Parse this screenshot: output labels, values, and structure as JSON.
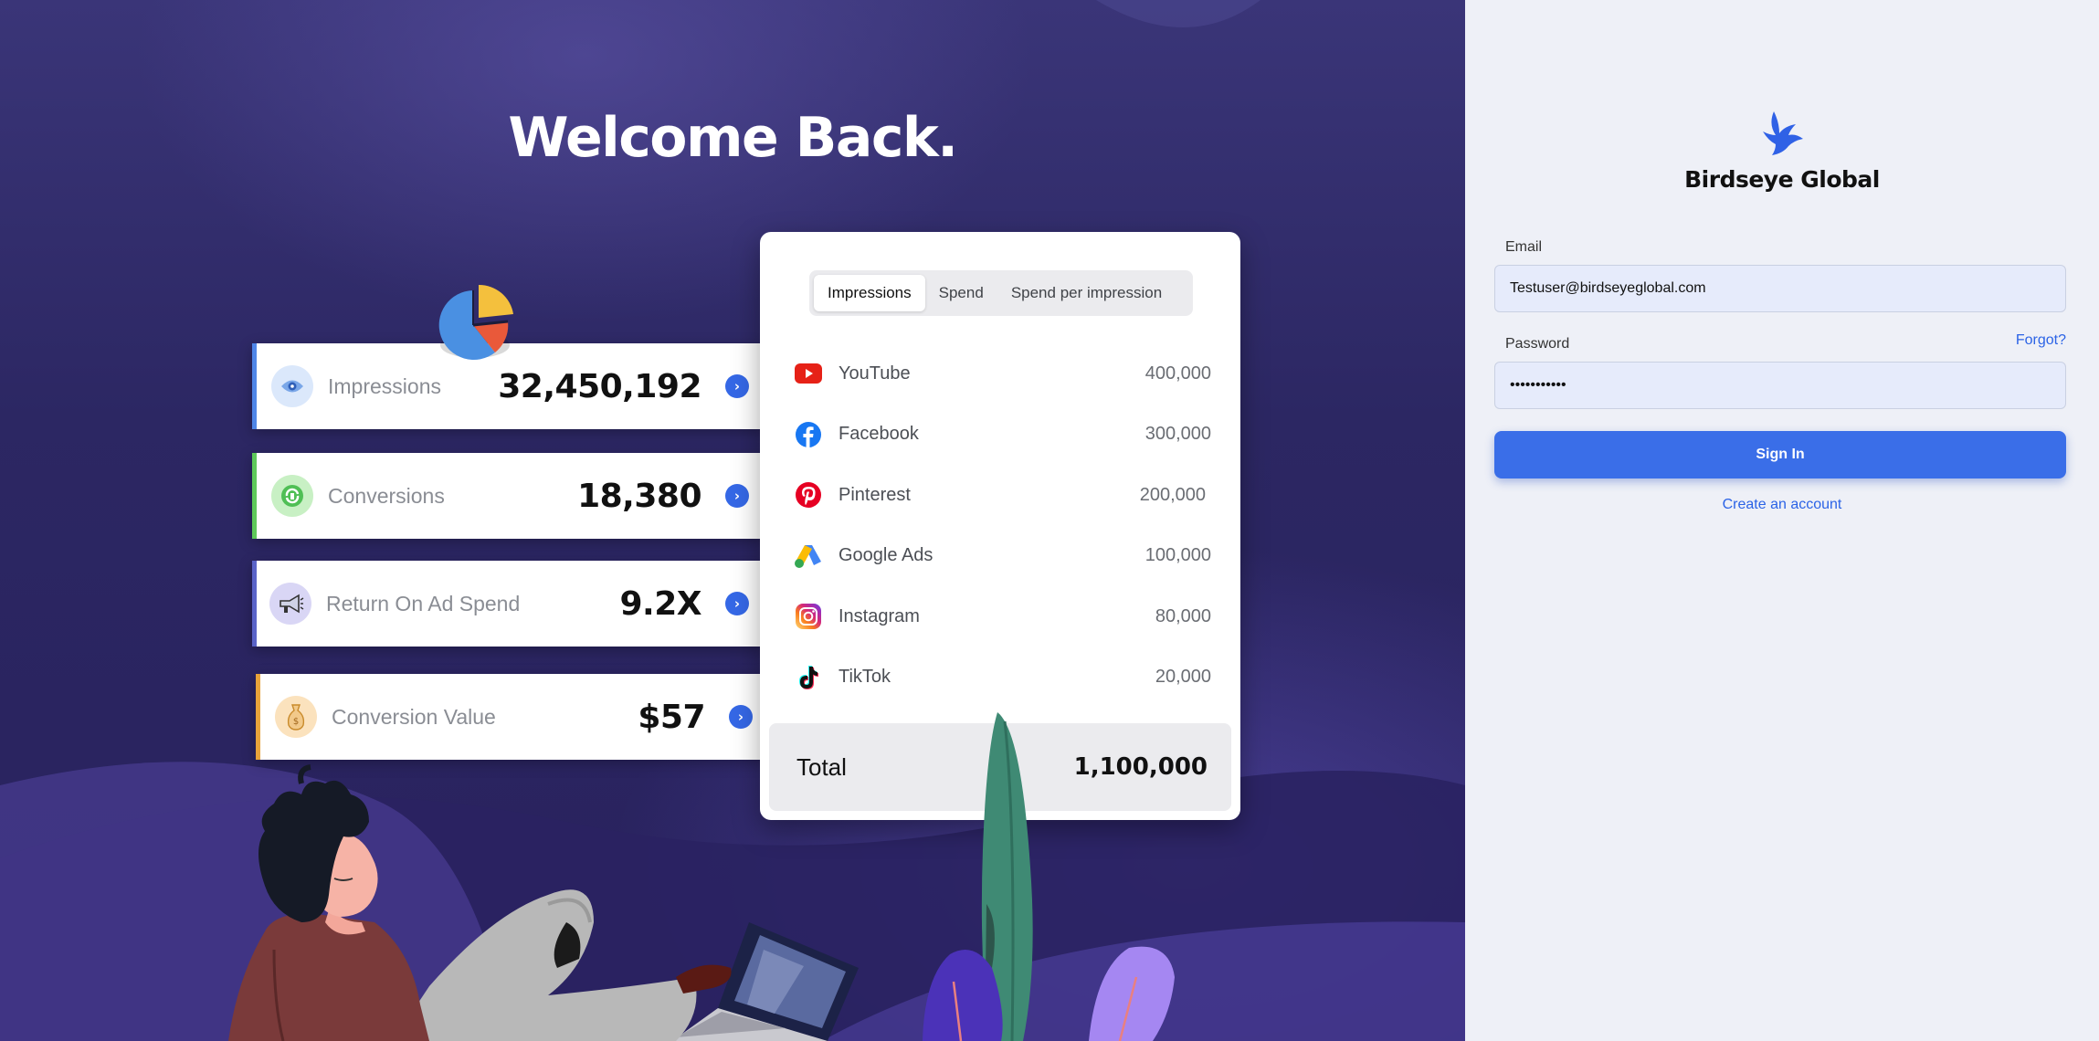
{
  "hero": {
    "title": "Welcome Back."
  },
  "metrics": [
    {
      "label": "Impressions",
      "value": "32,450,192",
      "icon": "eye-icon",
      "accent": "#4f86e8",
      "icon_bg": "#dbe8fb"
    },
    {
      "label": "Conversions",
      "value": "18,380",
      "icon": "conversion-icon",
      "accent": "#5ec95a",
      "icon_bg": "#c8f0c4"
    },
    {
      "label": "Return On Ad Spend",
      "value": "9.2X",
      "icon": "megaphone-icon",
      "accent": "#5a63c8",
      "icon_bg": "#d9d6f5"
    },
    {
      "label": "Conversion Value",
      "value": "$57",
      "icon": "money-bag-icon",
      "accent": "#e8a33a",
      "icon_bg": "#fbe2bd"
    }
  ],
  "table": {
    "tabs": [
      "Impressions",
      "Spend",
      "Spend per impression"
    ],
    "active_tab": "Impressions",
    "rows": [
      {
        "name": "YouTube",
        "value": "400,000",
        "icon": "youtube-icon"
      },
      {
        "name": "Facebook",
        "value": "300,000",
        "icon": "facebook-icon"
      },
      {
        "name": "Pinterest",
        "value": "200,000",
        "icon": "pinterest-icon"
      },
      {
        "name": "Google Ads",
        "value": "100,000",
        "icon": "google-ads-icon"
      },
      {
        "name": "Instagram",
        "value": "80,000",
        "icon": "instagram-icon"
      },
      {
        "name": "TikTok",
        "value": "20,000",
        "icon": "tiktok-icon"
      }
    ],
    "total_label": "Total",
    "total_value": "1,100,000"
  },
  "login": {
    "brand": "Birdseye Global",
    "logo_icon": "bird-logo-icon",
    "email_label": "Email",
    "email_value": "Testuser@birdseyeglobal.com",
    "password_label": "Password",
    "password_value": "•••••••••••",
    "forgot_label": "Forgot?",
    "signin_label": "Sign In",
    "create_account_label": "Create an account"
  },
  "colors": {
    "hero_bg": "#2c2763",
    "primary": "#3a6ee8",
    "link": "#2b63e6",
    "login_bg": "#eef0f7"
  }
}
